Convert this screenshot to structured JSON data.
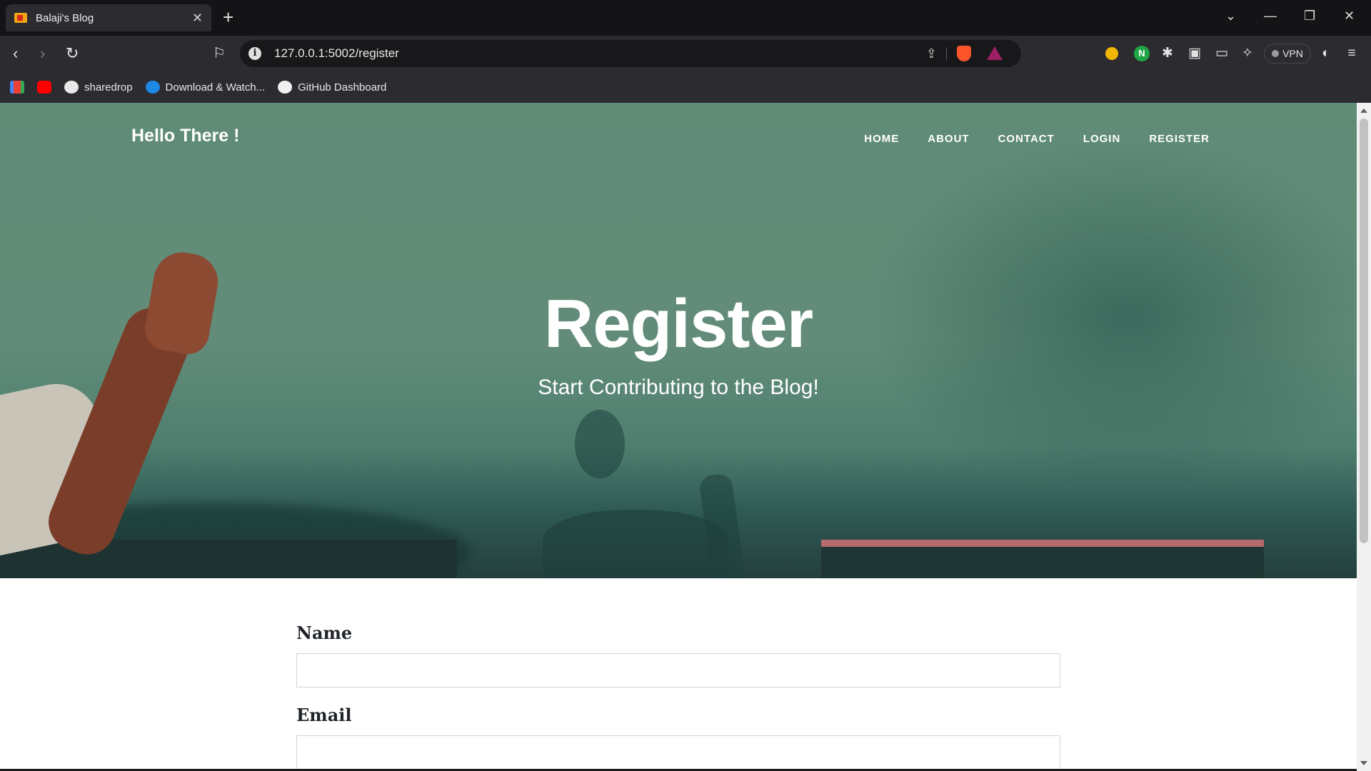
{
  "browser": {
    "tab_title": "Balaji's Blog",
    "tab_close": "✕",
    "new_tab": "+",
    "url": "127.0.0.1:5002/register",
    "vpn_label": "VPN",
    "bookmarks": [
      {
        "label": "",
        "icon": "gmail-icon"
      },
      {
        "label": "",
        "icon": "youtube-icon"
      },
      {
        "label": "sharedrop",
        "icon": "sharedrop-icon"
      },
      {
        "label": "Download & Watch...",
        "icon": "download-icon"
      },
      {
        "label": "GitHub Dashboard",
        "icon": "github-icon"
      }
    ]
  },
  "site": {
    "brand": "Hello There !",
    "nav": [
      "HOME",
      "ABOUT",
      "CONTACT",
      "LOGIN",
      "REGISTER"
    ],
    "heading": "Register",
    "subheading": "Start Contributing to the Blog!"
  },
  "form": {
    "name_label": "Name",
    "name_value": "",
    "email_label": "Email",
    "email_value": ""
  }
}
